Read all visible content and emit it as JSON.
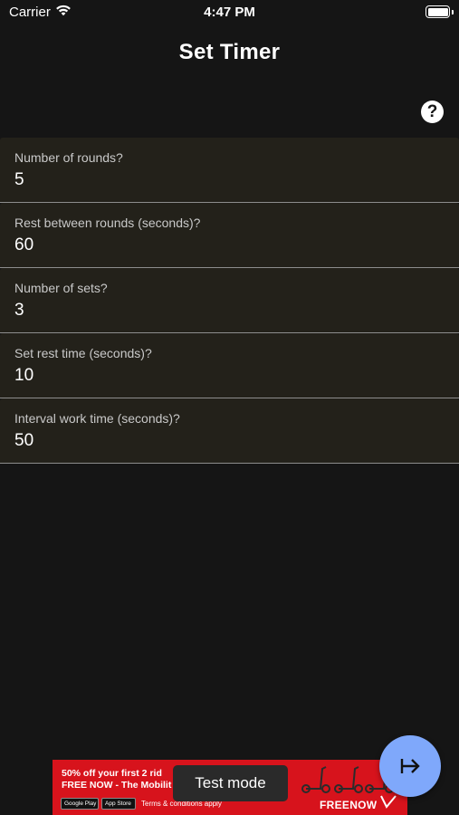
{
  "status_bar": {
    "carrier": "Carrier",
    "time": "4:47 PM",
    "wifi_icon": "wifi-icon",
    "battery_icon": "battery-icon",
    "battery_level": 1.0
  },
  "header": {
    "title": "Set Timer",
    "help_icon": "question-mark-icon",
    "help_glyph": "?"
  },
  "form": {
    "fields": [
      {
        "label": "Number of rounds?",
        "value": "5"
      },
      {
        "label": "Rest between rounds (seconds)?",
        "value": "60"
      },
      {
        "label": "Number of sets?",
        "value": "3"
      },
      {
        "label": "Set rest time (seconds)?",
        "value": "10"
      },
      {
        "label": "Interval work time (seconds)?",
        "value": "50"
      }
    ]
  },
  "ad": {
    "line1": "50% off your first 2 rid",
    "line2": "FREE NOW - The Mobilit",
    "store_google": "Google Play",
    "store_apple": "App Store",
    "terms": "Terms & conditions apply",
    "brand": "FREENOW",
    "test_mode": "Test mode",
    "background_color": "#d7131c"
  },
  "fab": {
    "icon": "arrow-right-to-bar-icon",
    "color": "#7fa8fb"
  },
  "colors": {
    "background": "#151515",
    "field_background": "#23211a",
    "field_underline": "#8d8d8d"
  }
}
